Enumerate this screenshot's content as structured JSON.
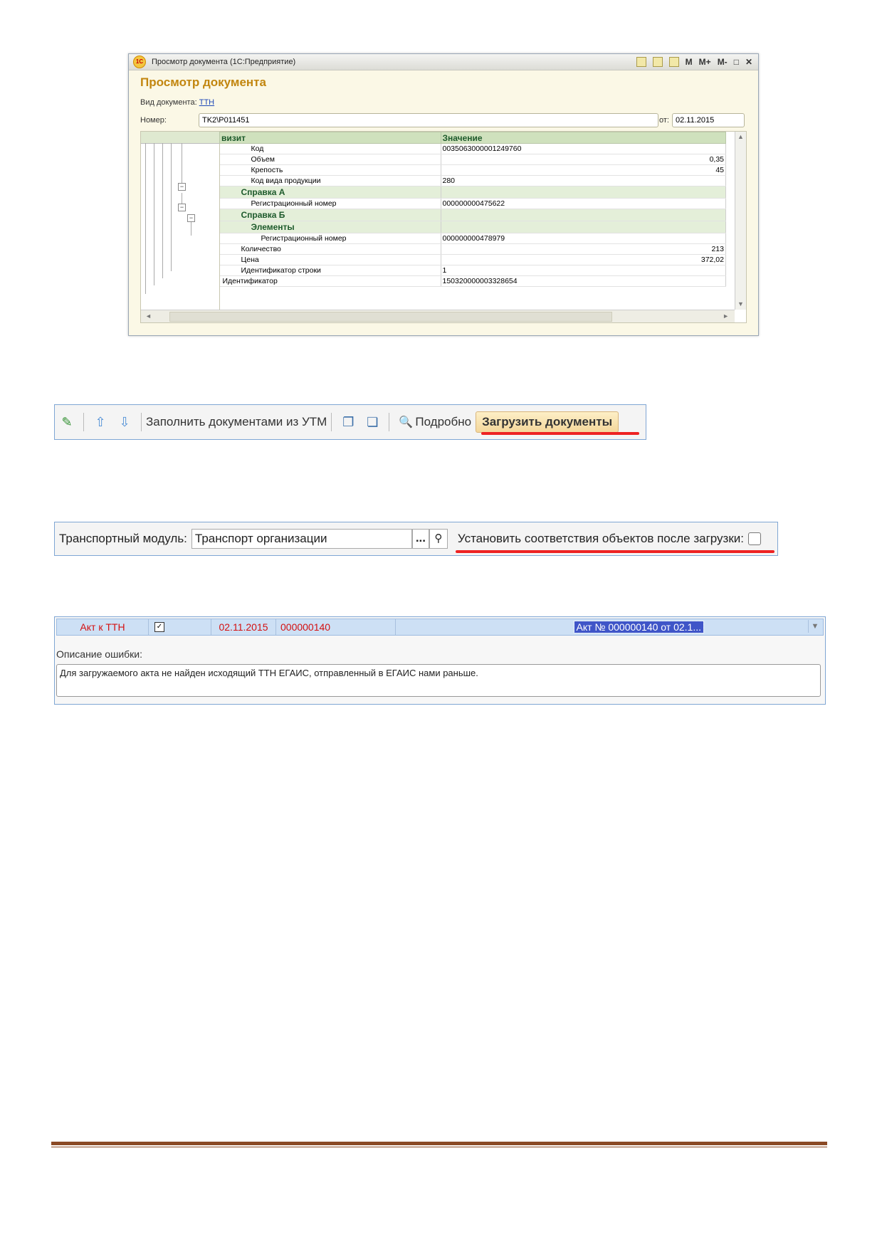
{
  "window": {
    "title": "Просмотр документа (1С:Предприятие)",
    "logo_text": "1C",
    "title_buttons": [
      "M",
      "M+",
      "M-",
      "□",
      "✕"
    ],
    "heading": "Просмотр документа",
    "doc_type_label": "Вид документа:",
    "doc_type_link": "ТТН",
    "number_label": "Номер:",
    "number_value": "TK2\\P011451",
    "date_label": "от:",
    "date_value": "02.11.2015",
    "columns": [
      "визит",
      "Значение"
    ],
    "rows": [
      {
        "name": "Код",
        "value": "0035063000001249760",
        "indent": 2,
        "align": "left",
        "group": false
      },
      {
        "name": "Объем",
        "value": "0,35",
        "indent": 2,
        "align": "right",
        "group": false
      },
      {
        "name": "Крепость",
        "value": "45",
        "indent": 2,
        "align": "right",
        "group": false
      },
      {
        "name": "Код вида продукции",
        "value": "280",
        "indent": 2,
        "align": "left",
        "group": false
      },
      {
        "name": "Справка А",
        "value": "",
        "indent": 1,
        "align": "left",
        "group": true
      },
      {
        "name": "Регистрационный номер",
        "value": "000000000475622",
        "indent": 2,
        "align": "left",
        "group": false
      },
      {
        "name": "Справка Б",
        "value": "",
        "indent": 1,
        "align": "left",
        "group": true
      },
      {
        "name": "Элементы",
        "value": "",
        "indent": 2,
        "align": "left",
        "group": true
      },
      {
        "name": "Регистрационный номер",
        "value": "000000000478979",
        "indent": 3,
        "align": "left",
        "group": false
      },
      {
        "name": "Количество",
        "value": "213",
        "indent": 1,
        "align": "right",
        "group": false
      },
      {
        "name": "Цена",
        "value": "372,02",
        "indent": 1,
        "align": "right",
        "group": false
      },
      {
        "name": "Идентификатор строки",
        "value": "1",
        "indent": 1,
        "align": "left",
        "group": false
      },
      {
        "name": "Идентификатор",
        "value": "150320000003328654",
        "indent": 0,
        "align": "left",
        "group": false
      }
    ]
  },
  "toolbar": {
    "fill_label": "Заполнить документами из УТМ",
    "details_label": "Подробно",
    "load_label": "Загрузить документы"
  },
  "transport": {
    "label": "Транспортный модуль:",
    "value": "Транспорт организации",
    "dots": "...",
    "match_label": "Установить соответствия объектов после загрузки:",
    "match_checked": false
  },
  "error_panel": {
    "row": {
      "type": "Акт к ТТН",
      "checked": "✓",
      "date": "02.11.2015",
      "number": "000000140",
      "document": "Акт № 000000140 от 02.1..."
    },
    "description_label": "Описание ошибки:",
    "description": "Для загружаемого акта не найден исходящий ТТН ЕГАИС, отправленный в ЕГАИС нами раньше."
  },
  "colors": {
    "heading": "#c2860f",
    "group_text": "#1d5a2b",
    "error_row_text": "#d41010",
    "highlight_line": "#e22222",
    "footer_line": "#8b4a25"
  }
}
